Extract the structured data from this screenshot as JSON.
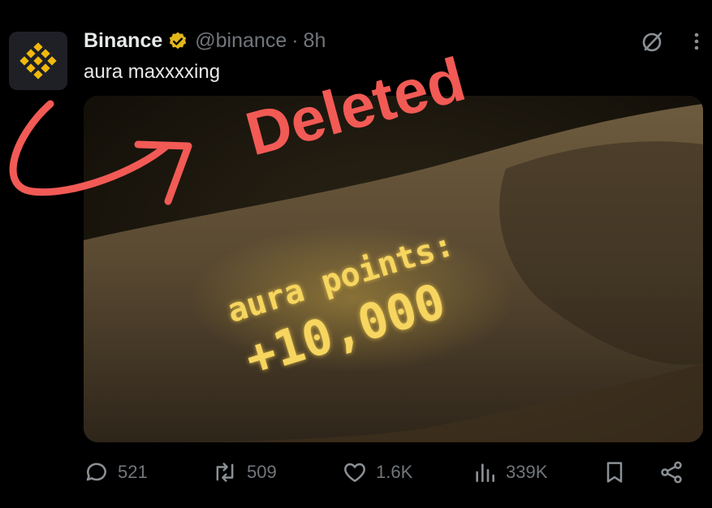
{
  "tweet": {
    "display_name": "Binance",
    "handle": "@binance",
    "separator": "·",
    "time": "8h",
    "text": "aura maxxxxing",
    "verified_icon": "verified-gold-badge-icon",
    "avatar_icon": "binance-logo-icon"
  },
  "media": {
    "overlay_line1": "aura points:",
    "overlay_line2": "+10,000",
    "overlay_color": "#f1c94a"
  },
  "annotation": {
    "label": "Deleted",
    "color": "#f25a55",
    "arrow_icon": "curved-arrow-icon"
  },
  "actions": {
    "replies": "521",
    "reposts": "509",
    "likes": "1.6K",
    "views": "339K",
    "icons": [
      "reply-icon",
      "repost-icon",
      "like-icon",
      "views-icon",
      "bookmark-icon",
      "share-icon"
    ]
  },
  "top_icons": [
    "grok-icon",
    "more-icon"
  ],
  "colors": {
    "background": "#000000",
    "text": "#e7e9ea",
    "muted": "#71767b",
    "brand": "#f0b90b"
  }
}
